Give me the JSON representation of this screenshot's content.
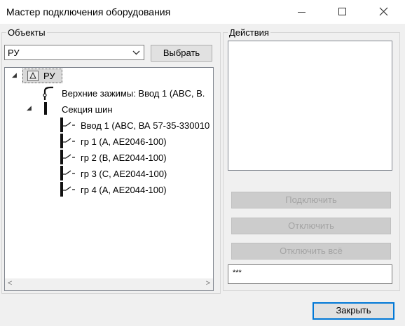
{
  "window": {
    "title": "Мастер подключения оборудования"
  },
  "objects": {
    "label": "Объекты",
    "combo_value": "РУ",
    "select_button": "Выбрать",
    "tree": {
      "root": "РУ",
      "upper_clamps": "Верхние зажимы: Ввод 1 (ABC, В.",
      "busbar_section": "Секция шин",
      "items": [
        "Ввод 1 (ABC, ВА 57-35-330010",
        "гр 1 (A, AE2046-100)",
        "гр 2 (B, AE2044-100)",
        "гр 3 (C, AE2044-100)",
        "гр 4 (A, AE2044-100)"
      ]
    }
  },
  "actions": {
    "label": "Действия",
    "connect_button": "Подключить",
    "disconnect_button": "Отключить",
    "disconnect_all_button": "Отключить всё",
    "status_value": "***"
  },
  "close_button": "Закрыть",
  "colors": {
    "focus_border": "#0078d7",
    "disabled_text": "#a4a4a4"
  },
  "icons": [
    "minimize-icon",
    "maximize-icon",
    "close-icon",
    "chevron-down-icon",
    "expand-arrow-icon",
    "switchboard-icon",
    "clamp-icon",
    "busbar-icon",
    "breaker-icon",
    "scroll-left-icon",
    "scroll-right-icon"
  ]
}
